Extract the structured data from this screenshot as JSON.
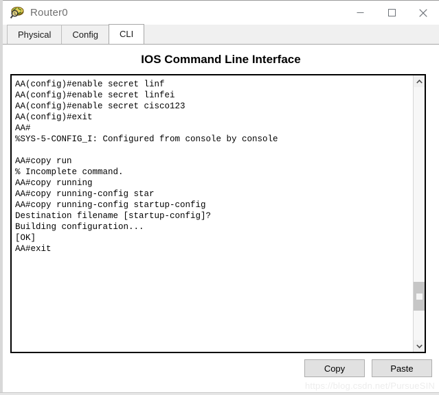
{
  "window": {
    "title": "Router0",
    "icon": "router-icon",
    "controls": {
      "minimize": "minimize-icon",
      "maximize": "maximize-icon",
      "close": "close-icon"
    }
  },
  "tabs": [
    {
      "label": "Physical",
      "active": false
    },
    {
      "label": "Config",
      "active": false
    },
    {
      "label": "CLI",
      "active": true
    }
  ],
  "cli": {
    "heading": "IOS Command Line Interface",
    "lines": [
      "AA(config)#enable secret linf",
      "AA(config)#enable secret linfei",
      "AA(config)#enable secret cisco123",
      "AA(config)#exit",
      "AA#",
      "%SYS-5-CONFIG_I: Configured from console by console",
      "",
      "AA#copy run",
      "% Incomplete command.",
      "AA#copy running",
      "AA#copy running-config star",
      "AA#copy running-config startup-config",
      "Destination filename [startup-config]?",
      "Building configuration...",
      "[OK]",
      "AA#exit"
    ]
  },
  "scrollbar": {
    "up_arrow": "chevron-up-icon",
    "down_arrow": "chevron-down-icon",
    "thumb_position_percent": 77
  },
  "buttons": {
    "copy": "Copy",
    "paste": "Paste"
  },
  "watermark": "https://blog.csdn.net/PursueSIN",
  "colors": {
    "titlebar_bg": "#ffffff",
    "tabstrip_bg": "#f0f0f0",
    "active_tab_bg": "#ffffff",
    "terminal_border": "#000000",
    "button_bg": "#e1e1e1",
    "scrollbar_thumb": "#c6c6c6"
  }
}
